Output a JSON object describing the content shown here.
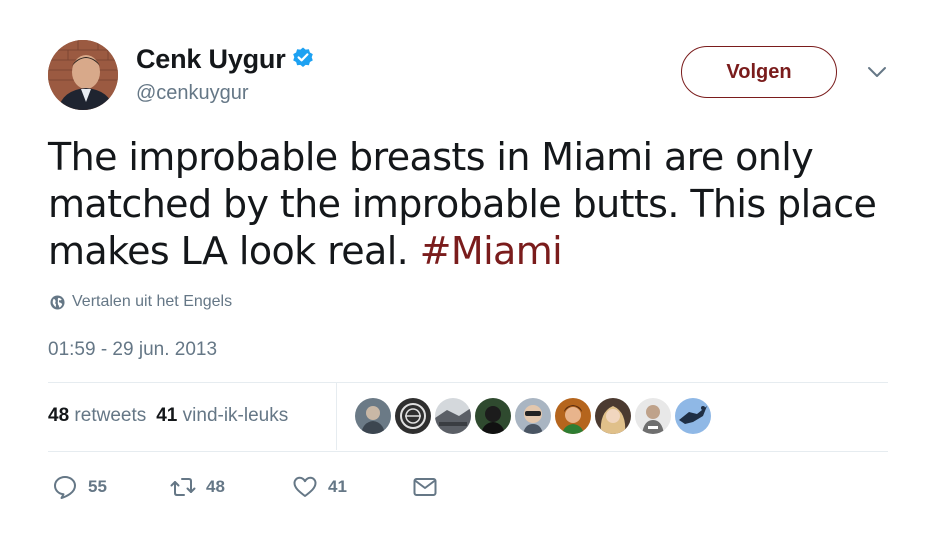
{
  "user": {
    "name": "Cenk Uygur",
    "handle": "@cenkuygur",
    "verified": true
  },
  "follow_button": {
    "label": "Volgen"
  },
  "tweet": {
    "text_before_hashtag": "The improbable breasts in Miami are only matched by the improbable butts. This place makes LA look real. ",
    "hashtag": "#Miami",
    "translate_label": "Vertalen uit het Engels",
    "timestamp": "01:59 - 29 jun. 2013"
  },
  "stats": {
    "retweets_count": "48",
    "retweets_label": "retweets",
    "likes_count": "41",
    "likes_label": "vind-ik-leuks"
  },
  "likers": [
    {
      "icon": "liker-avatar-1",
      "color": "#6b7a86"
    },
    {
      "icon": "liker-avatar-2",
      "color": "#3d3d3d"
    },
    {
      "icon": "liker-avatar-3",
      "color": "#5b5f66"
    },
    {
      "icon": "liker-avatar-4",
      "color": "#2f4a2f"
    },
    {
      "icon": "liker-avatar-5",
      "color": "#7f8a99"
    },
    {
      "icon": "liker-avatar-6",
      "color": "#b5651d"
    },
    {
      "icon": "liker-avatar-7",
      "color": "#c9a27a"
    },
    {
      "icon": "liker-avatar-8",
      "color": "#8c8c8c"
    },
    {
      "icon": "liker-avatar-9",
      "color": "#3b6ea8"
    }
  ],
  "actions": {
    "reply_count": "55",
    "retweet_count": "48",
    "like_count": "41"
  },
  "colors": {
    "accent": "#7a1c1c",
    "verified": "#1da1f2",
    "secondary_text": "#657786",
    "primary_text": "#14171a",
    "divider": "#e6ecf0"
  }
}
